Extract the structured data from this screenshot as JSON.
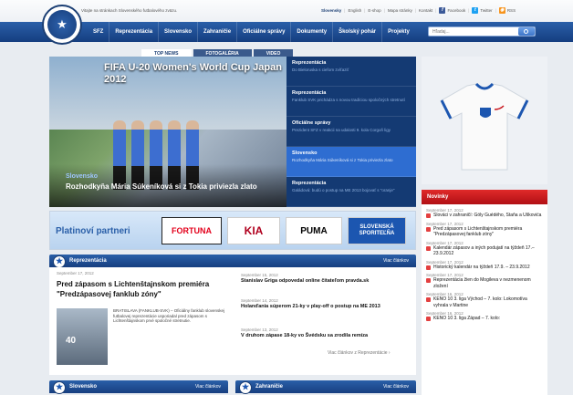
{
  "topbar": {
    "welcome": "Vitajte na stránkach Slovenského futbalového zväzu.",
    "links": [
      "Slovensky",
      "English",
      "E-shop",
      "Mapa stránky",
      "Kontakt"
    ],
    "social": [
      "Facebook",
      "Twitter",
      "RSS"
    ]
  },
  "nav": {
    "items": [
      "SFZ",
      "Reprezentácia",
      "Slovensko",
      "Zahraničie",
      "Oficiálne správy",
      "Dokumenty",
      "Školský pohár",
      "Projekty"
    ],
    "search_placeholder": "Hľadaj..."
  },
  "tabs": [
    "TOP NEWS",
    "FOTOGALÉRIA",
    "VIDEO"
  ],
  "hero": {
    "banner": "FIFA U-20 Women's World Cup Japan 2012",
    "category": "Slovensko",
    "title": "Rozhodkyňa Mária Súkeníková si z Tokia priviezla zlato"
  },
  "hero_list": [
    {
      "title": "Reprezentácia",
      "desc": "Do Bieloruska s cieľom zvíťaziť"
    },
    {
      "title": "Reprezentácia",
      "desc": "Fanklub SVK prichádza s novou tradíciou spoločných stretnutí"
    },
    {
      "title": "Oficiálne správy",
      "desc": "Prezident SFZ v reakcii na udalosti 9. kola Corgoň ligy"
    },
    {
      "title": "Slovensko",
      "desc": "Rozhodkyňa Mária Súkeníková si z Tokia priviezla zlato"
    },
    {
      "title": "Reprezentácia",
      "desc": "Galádová: budú o postup na ME 2013 bojovať s \"oranje\""
    }
  ],
  "partners": {
    "label": "Platinoví partneri",
    "logos": [
      "FORTUNA",
      "KIA",
      "PUMA",
      "SLOVENSKÁ SPORITEĽŇA"
    ]
  },
  "reprezentacia": {
    "title": "Reprezentácia",
    "more": "Viac článkov",
    "main": {
      "date": "September 17, 2012",
      "title": "Pred zápasom s Lichtenštajnskom premiéra \"Predzápasovej fanklub zóny\"",
      "text": "BRATISLAVA (FANKLUB-SVK) – Oficiálny fanklub slovenskej futbalovej reprezentácie usporiadal pred zápasom s Lichtenštajnskom prvé spoločné stretnutie."
    },
    "news": [
      {
        "date": "September 15, 2012",
        "title": "Stanislav Griga odpovedal online čitateľom pravda.sk"
      },
      {
        "date": "September 14, 2012",
        "title": "Holanďania súperom 21-ky v play-off o postup na ME 2013"
      },
      {
        "date": "September 13, 2012",
        "title": "V druhom zápase 18-ky vo Švédsku sa zrodila remíza"
      }
    ],
    "more_bottom": "Viac článkov z Reprezentácie ›"
  },
  "bottom_sections": [
    {
      "title": "Slovensko",
      "more": "Viac článkov"
    },
    {
      "title": "Zahraničie",
      "more": "Viac článkov"
    }
  ],
  "novinky": {
    "title": "Novinky",
    "items": [
      {
        "date": "September 17, 2012",
        "title": "Slováci v zahraničí: Góly Guédého, Staňa a Uškovića"
      },
      {
        "date": "September 17, 2012",
        "title": "Pred zápasom s Lichtenštajnskom premiéra \"Predzápasovej fanklub zóny\""
      },
      {
        "date": "September 17, 2012",
        "title": "Kalendár zápasov a iných podujatí na týždeň 17.–23.9.2012"
      },
      {
        "date": "September 17, 2012",
        "title": "Historický kalendár na týždeň 17.9. – 23.9.2012"
      },
      {
        "date": "September 17, 2012",
        "title": "Reprezentácia žien do Mogileva v nezmenenom zložení"
      },
      {
        "date": "September 16, 2012",
        "title": "KENO 10 3. liga Východ – 7. kolo: Lokomotíva vyhrala v Martine"
      },
      {
        "date": "September 16, 2012",
        "title": "KENO 10 3. liga Západ – 7. kolo:"
      }
    ]
  },
  "colors": {
    "brand": "#1c3f74",
    "nav": "#2a5fa8",
    "accent_red": "#c8161d"
  }
}
